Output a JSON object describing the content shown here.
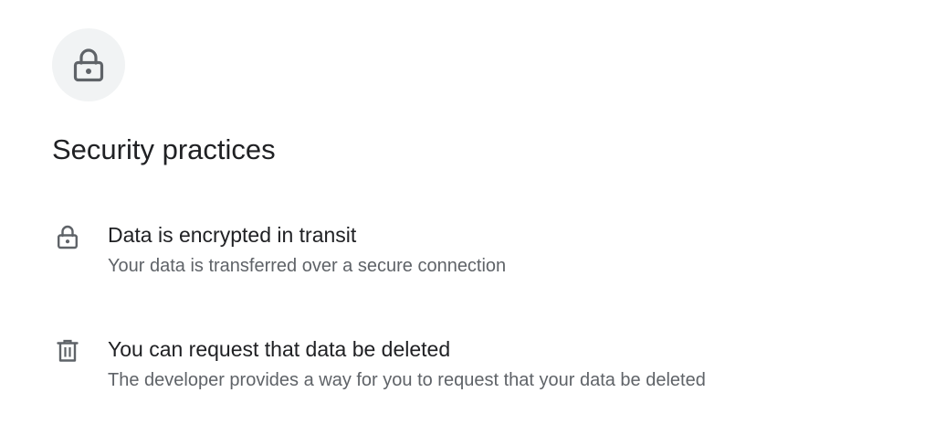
{
  "header": {
    "icon": "lock-icon",
    "title": "Security practices"
  },
  "items": [
    {
      "icon": "lock-icon",
      "title": "Data is encrypted in transit",
      "description": "Your data is transferred over a secure connection"
    },
    {
      "icon": "trash-icon",
      "title": "You can request that data be deleted",
      "description": "The developer provides a way for you to request that your data be deleted"
    }
  ],
  "colors": {
    "title_text": "#202124",
    "secondary_text": "#5f6368",
    "icon": "#5f6368",
    "icon_circle_bg": "#f1f3f4"
  }
}
